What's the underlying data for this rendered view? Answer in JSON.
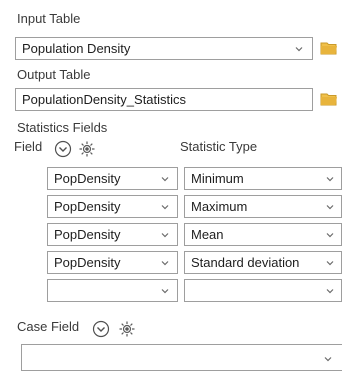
{
  "input_table": {
    "label": "Input Table",
    "value": "Population Density"
  },
  "output_table": {
    "label": "Output Table",
    "value": "PopulationDensity_Statistics"
  },
  "statistics_fields": {
    "label": "Statistics Fields",
    "field_header": "Field",
    "stat_type_header": "Statistic Type",
    "rows": [
      {
        "field": "PopDensity",
        "stat": "Minimum"
      },
      {
        "field": "PopDensity",
        "stat": "Maximum"
      },
      {
        "field": "PopDensity",
        "stat": "Mean"
      },
      {
        "field": "PopDensity",
        "stat": "Standard deviation"
      },
      {
        "field": "",
        "stat": ""
      }
    ]
  },
  "case_field": {
    "label": "Case Field",
    "value": ""
  },
  "colors": {
    "folder": "#e8b43c",
    "border": "#9e9e9e",
    "text": "#1e1e1e"
  },
  "icons": {
    "dropdown": "chevron-down-icon",
    "browse": "folder-icon",
    "add_many": "circle-chevron-icon",
    "options": "gear-icon"
  }
}
